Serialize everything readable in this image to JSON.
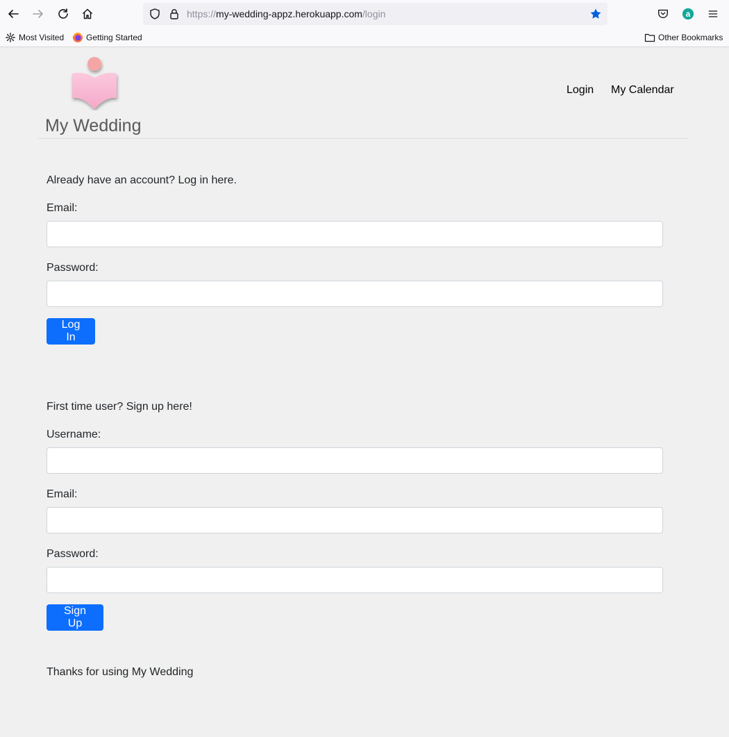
{
  "browser": {
    "url_scheme": "https://",
    "url_host": "my-wedding-appz.herokuapp.com",
    "url_path": "/login",
    "bookmarks": {
      "most_visited": "Most Visited",
      "getting_started": "Getting Started",
      "other_bookmarks": "Other Bookmarks"
    },
    "colors": {
      "star": "#0060df",
      "account": "#12a89a"
    }
  },
  "header": {
    "brand": "My Wedding",
    "nav": {
      "login": "Login",
      "calendar": "My Calendar"
    },
    "logo_colors": {
      "head": "#f4a6a6",
      "book": "#f8b4d0"
    }
  },
  "login": {
    "prompt": "Already have an account? Log in here.",
    "email_label": "Email:",
    "password_label": "Password:",
    "submit": "Log In"
  },
  "signup": {
    "prompt": "First time user? Sign up here!",
    "username_label": "Username:",
    "email_label": "Email:",
    "password_label": "Password:",
    "submit": "Sign Up"
  },
  "footer": {
    "text": "Thanks for using My Wedding"
  },
  "accent_color": "#0d6efd"
}
